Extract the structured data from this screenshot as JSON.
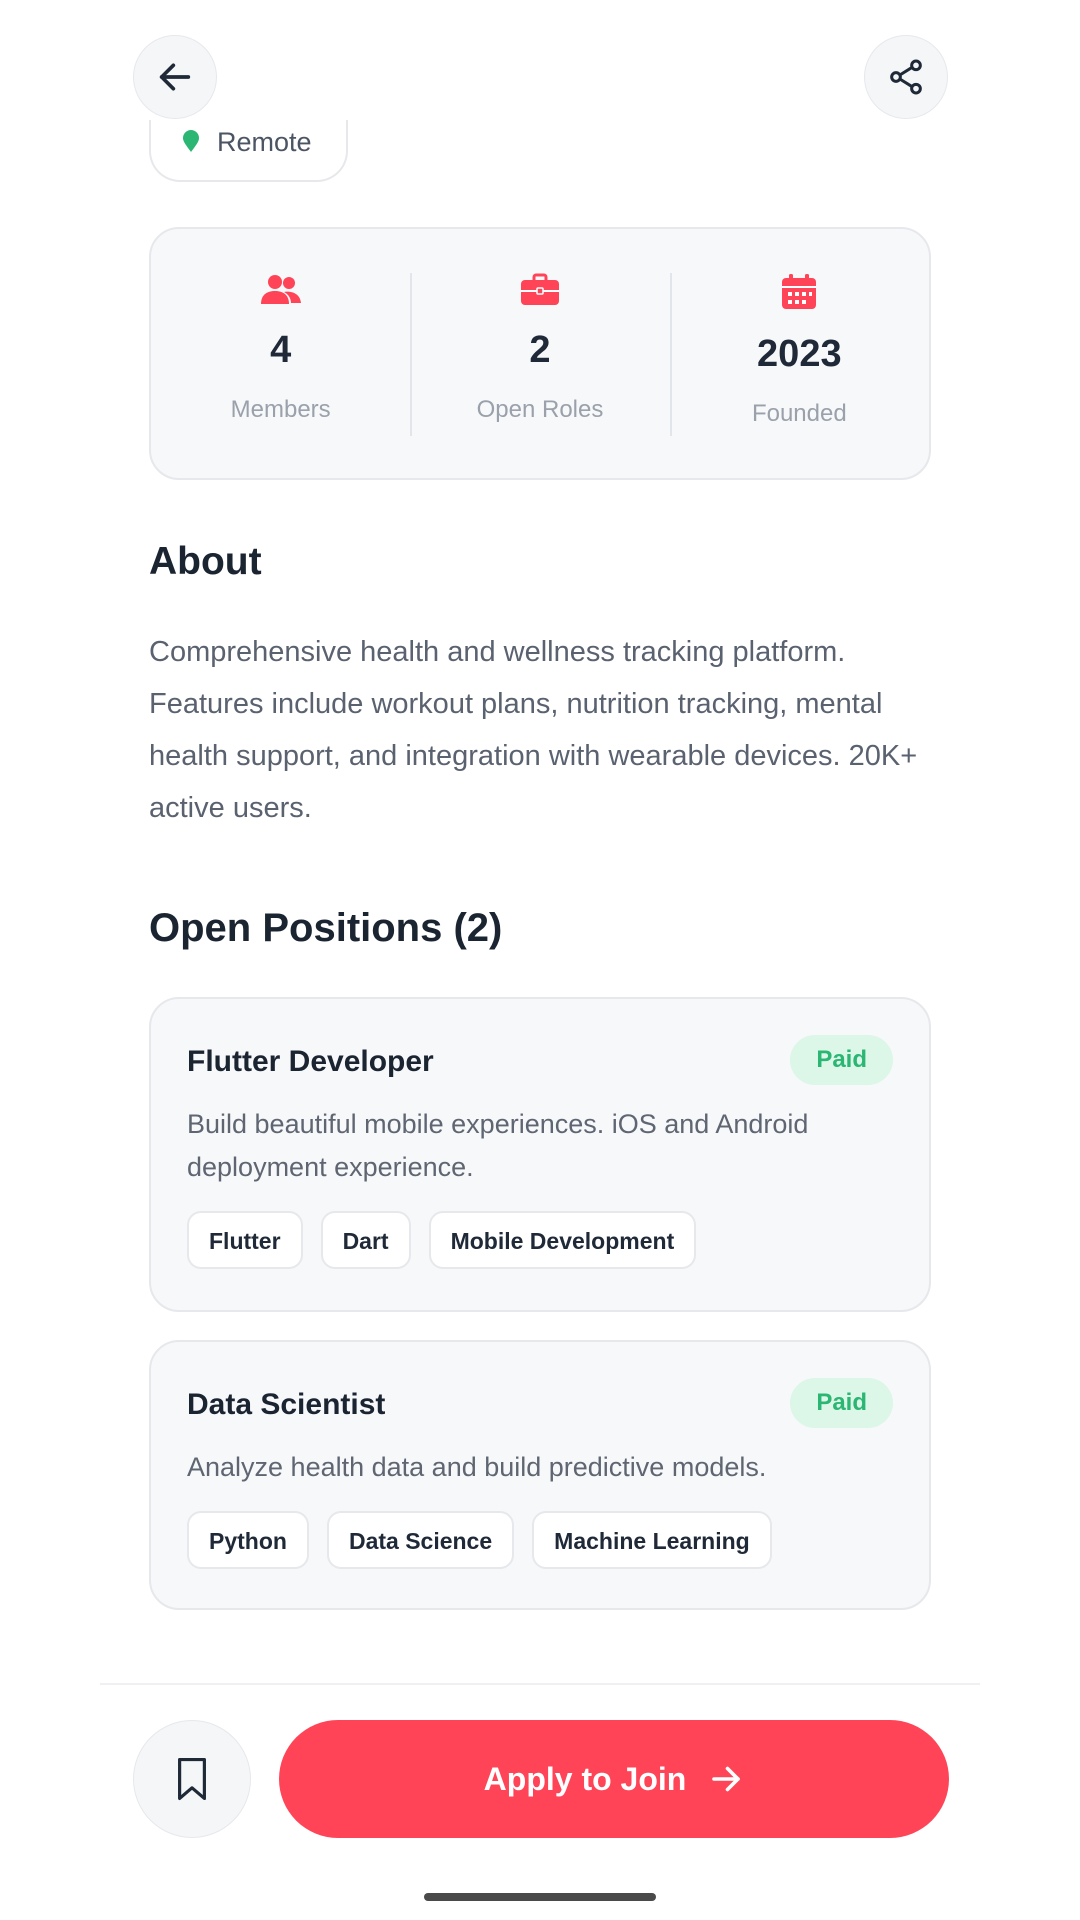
{
  "header": {
    "back_icon": "arrow-left-icon",
    "share_icon": "share-icon"
  },
  "location_chip": {
    "label": "Remote",
    "icon": "location-pin-icon",
    "icon_color": "#2bb673"
  },
  "stats": [
    {
      "value": "4",
      "label": "Members",
      "icon": "users-icon"
    },
    {
      "value": "2",
      "label": "Open Roles",
      "icon": "briefcase-icon"
    },
    {
      "value": "2023",
      "label": "Founded",
      "icon": "calendar-icon"
    }
  ],
  "about": {
    "title": "About",
    "text": "Comprehensive health and wellness tracking platform. Features include workout plans, nutrition tracking, mental health support, and integration with wearable devices. 20K+ active users."
  },
  "positions": {
    "title": "Open Positions (2)",
    "items": [
      {
        "title": "Flutter Developer",
        "badge": "Paid",
        "description": "Build beautiful mobile experiences. iOS and Android deployment experience.",
        "tags": [
          "Flutter",
          "Dart",
          "Mobile Development"
        ]
      },
      {
        "title": "Data Scientist",
        "badge": "Paid",
        "description": "Analyze health data and build predictive models.",
        "tags": [
          "Python",
          "Data Science",
          "Machine Learning"
        ]
      }
    ]
  },
  "footer": {
    "bookmark_icon": "bookmark-icon",
    "apply_label": "Apply to Join",
    "apply_icon": "arrow-right-icon"
  },
  "colors": {
    "accent": "#ff4458",
    "paid_text": "#2bb673",
    "paid_bg": "#dcf6e8"
  }
}
